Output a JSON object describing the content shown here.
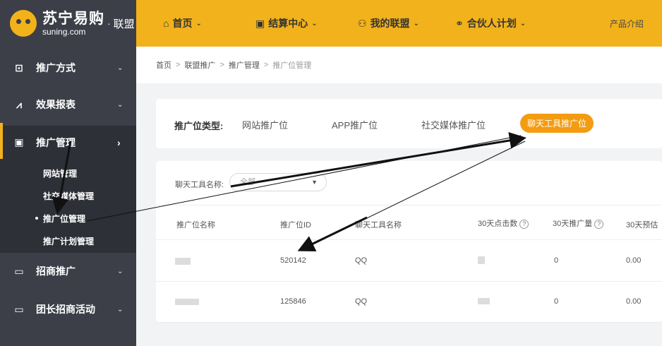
{
  "header": {
    "logo_cn": "苏宁易购",
    "logo_en": "suning.com",
    "logo_sep": "·",
    "logo_union": "联盟",
    "nav": [
      {
        "label": "首页",
        "icon": "⌂"
      },
      {
        "label": "结算中心",
        "icon": "▣"
      },
      {
        "label": "我的联盟",
        "icon": "⚇"
      },
      {
        "label": "合伙人计划",
        "icon": "⚭"
      }
    ],
    "chevron": "⌄",
    "right_link": "产品介绍"
  },
  "sidebar": {
    "items": [
      {
        "label": "推广方式",
        "icon": "⊡"
      },
      {
        "label": "效果报表",
        "icon": "⩘"
      },
      {
        "label": "推广管理",
        "icon": "▣"
      },
      {
        "label": "招商推广",
        "icon": "▭"
      },
      {
        "label": "团长招商活动",
        "icon": "▭"
      }
    ],
    "submenu": [
      "网站管理",
      "社交媒体管理",
      "推广位管理",
      "推广计划管理"
    ],
    "chevron_down": "⌄",
    "chevron_right": "›"
  },
  "breadcrumb": {
    "items": [
      "首页",
      "联盟推广",
      "推广管理",
      "推广位管理"
    ],
    "sep": ">"
  },
  "type_filter": {
    "label": "推广位类型:",
    "options": [
      "网站推广位",
      "APP推广位",
      "社交媒体推广位",
      "聊天工具推广位"
    ],
    "active_index": 3
  },
  "filter": {
    "label": "聊天工具名称:",
    "value": "全部",
    "caret": "▼"
  },
  "table": {
    "headers": [
      "推广位名称",
      "推广位ID",
      "聊天工具名称",
      "30天点击数",
      "30天推广量",
      "30天预估"
    ],
    "help_mark": "?",
    "rows": [
      {
        "id": "520142",
        "tool": "QQ",
        "clicks": "",
        "promo": "0",
        "est": "0.00"
      },
      {
        "id": "125846",
        "tool": "QQ",
        "clicks": "",
        "promo": "0",
        "est": "0.00"
      }
    ]
  },
  "colors": {
    "brand_yellow": "#f2b21b",
    "sidebar_bg": "#3c3f48",
    "active_pill": "#f39c12"
  }
}
